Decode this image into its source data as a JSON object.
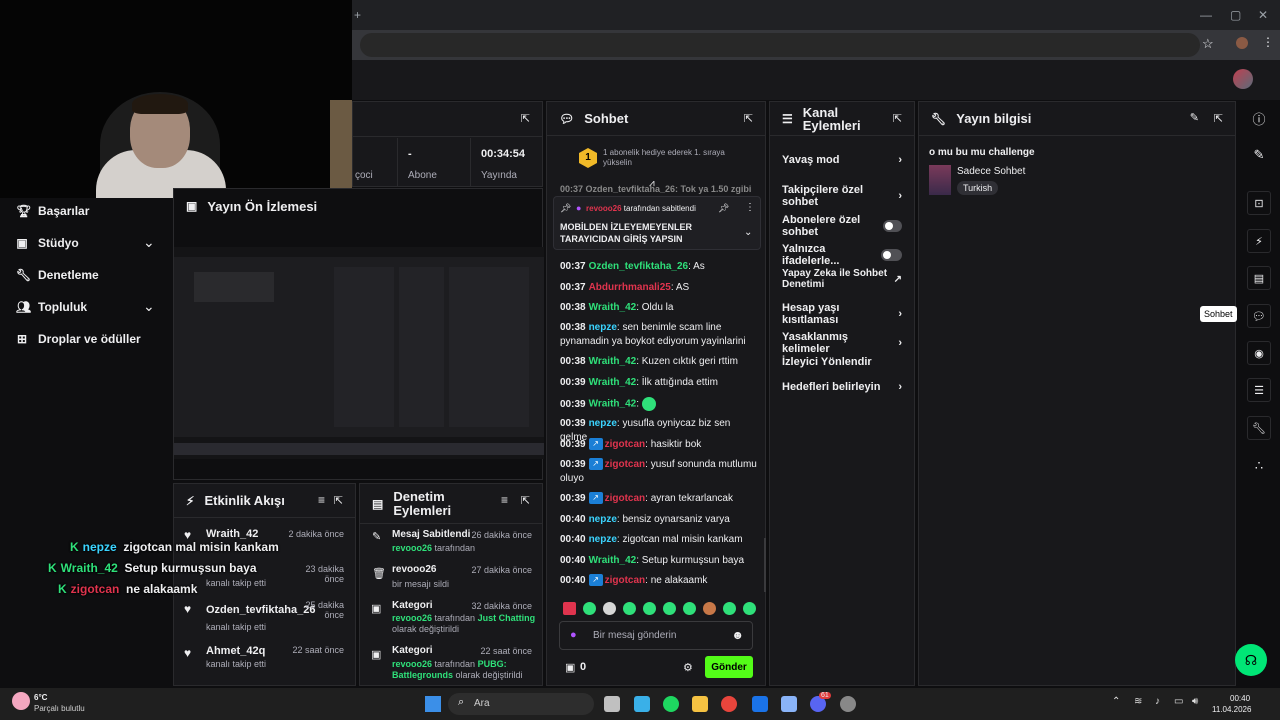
{
  "browser": {
    "win_minimize": "—",
    "win_restore": "▢",
    "win_close": "✕",
    "tab_plus": "+"
  },
  "sidebar": {
    "items": [
      {
        "label": "Başarılar",
        "icon": "trophy-icon"
      },
      {
        "label": "Stüdyo",
        "icon": "studio-icon",
        "expandable": true
      },
      {
        "label": "Denetleme",
        "icon": "wrench-icon"
      },
      {
        "label": "Topluluk",
        "icon": "community-icon",
        "expandable": true
      },
      {
        "label": "Droplar ve ödüller",
        "icon": "drops-icon"
      }
    ]
  },
  "stats": {
    "col1_value": "",
    "col1_label": "çoci",
    "col2_value": "-",
    "col2_label": "Abone",
    "col3_value": "00:34:54",
    "col3_label": "Yayında"
  },
  "preview": {
    "title": "Yayın Ön İzlemesi"
  },
  "activity": {
    "title": "Etkinlik Akışı",
    "items": [
      {
        "name": "Wraith_42",
        "time": "2 dakika önce",
        "sub": "kanalı takip etti"
      },
      {
        "name": "",
        "time": "23 dakika önce",
        "sub": "kanalı takip etti"
      },
      {
        "name": "Ozden_tevfiktaha_26",
        "time": "25 dakika önce",
        "sub": "kanalı takip etti"
      },
      {
        "name": "Ahmet_42q",
        "time": "22 saat önce",
        "sub": "kanalı takip etti"
      }
    ]
  },
  "modlog": {
    "title": "Denetim Eylemleri",
    "items": [
      {
        "title": "Mesaj Sabitlendi",
        "time": "26 dakika önce",
        "user": "revooo26",
        "rest": " tarafından"
      },
      {
        "title": "revooo26",
        "time": "27 dakika önce",
        "user": "",
        "rest": "bir mesajı sildi"
      },
      {
        "title": "Kategori",
        "time": "32 dakika önce",
        "user": "revooo26",
        "rest": " tarafından ",
        "highlight": "Just Chatting",
        "after": "olarak değiştirildi"
      },
      {
        "title": "Kategori",
        "time": "22 saat önce",
        "user": "revooo26",
        "rest": " tarafından ",
        "highlight": "PUBG: Battlegrounds",
        "after": " olarak değiştirildi"
      }
    ]
  },
  "chat": {
    "title": "Sohbet",
    "gift_text": "1 abonelik hediye ederek 1. sıraya yükselin",
    "gift_rank": "1",
    "clipped_line": "00:37 Ozden_tevfiktaha_26: Tok ya 1.50 zgibi",
    "pinned_by": "revooo26",
    "pinned_by_suffix": " tarafından sabitlendi",
    "pinned_text": "MOBİLDEN İZLEYEMEYENLER TARAYICIDAN GİRİŞ YAPSIN",
    "messages": [
      {
        "t": "00:37",
        "u": "Ozden_tevfiktaha_26",
        "c": "green",
        "m": ": As"
      },
      {
        "t": "00:37",
        "u": "Abdurrhmanali25",
        "c": "red",
        "m": ": AS"
      },
      {
        "t": "00:38",
        "u": "Wraith_42",
        "c": "green",
        "m": ": Oldu la"
      },
      {
        "t": "00:38",
        "u": "nepze",
        "c": "cyan",
        "m": ": sen benimle scam line pynamadin ya boykot ediyorum yayinlarini"
      },
      {
        "t": "00:38",
        "u": "Wraith_42",
        "c": "green",
        "m": ": Kuzen cıktık geri rttim"
      },
      {
        "t": "00:39",
        "u": "Wraith_42",
        "c": "green",
        "m": ": İlk attığında ettim"
      },
      {
        "t": "00:39",
        "u": "Wraith_42",
        "c": "green",
        "m": ":"
      },
      {
        "t": "00:39",
        "u": "nepze",
        "c": "cyan",
        "m": ": yusufla oyniycaz biz sen gelme"
      },
      {
        "t": "00:39",
        "u": "zigotcan",
        "c": "red",
        "m": ": hasiktir bok",
        "badge": true
      },
      {
        "t": "00:39",
        "u": "zigotcan",
        "c": "red",
        "m": ": yusuf sonunda mutlumu oluyo",
        "badge": true
      },
      {
        "t": "00:39",
        "u": "zigotcan",
        "c": "red",
        "m": ": ayran tekrarlancak",
        "badge": true
      },
      {
        "t": "00:40",
        "u": "nepze",
        "c": "cyan",
        "m": ": bensiz oynarsaniz varya"
      },
      {
        "t": "00:40",
        "u": "nepze",
        "c": "cyan",
        "m": ": zigotcan mal misin kankam"
      },
      {
        "t": "00:40",
        "u": "Wraith_42",
        "c": "green",
        "m": ": Setup kurmuşsun baya"
      },
      {
        "t": "00:40",
        "u": "zigotcan",
        "c": "red",
        "m": ": ne alakaamk",
        "badge": true
      }
    ],
    "input_placeholder": "Bir mesaj gönderin",
    "points": "0",
    "send_label": "Gönder"
  },
  "channel_actions": {
    "title": "Kanal Eylemleri",
    "items": [
      {
        "label": "Yavaş mod",
        "control": "chevron"
      },
      {
        "label": "Takipçilere özel sohbet",
        "control": "chevron"
      },
      {
        "label": "Abonelere özel sohbet",
        "control": "toggle"
      },
      {
        "label": "Yalnızca ifadelerle...",
        "control": "toggle"
      },
      {
        "label": "Yapay Zeka ile Sohbet Denetimi",
        "control": "external"
      },
      {
        "label": "Hesap yaşı kısıtlaması",
        "control": "chevron"
      },
      {
        "label": "Yasaklanmış kelimeler",
        "control": "chevron"
      },
      {
        "label": "İzleyici Yönlendir",
        "control": "none"
      },
      {
        "label": "Hedefleri belirleyin",
        "control": "chevron"
      }
    ]
  },
  "stream_info": {
    "title": "Yayın bilgisi",
    "stream_title": "o mu bu mu challenge",
    "category": "Sadece Sohbet",
    "tag": "Turkish"
  },
  "rail": {
    "tooltip": "Sohbet"
  },
  "overlay_chat": [
    {
      "u": "nepze",
      "c": "cyan",
      "m": "zigotcan mal misin kankam"
    },
    {
      "u": "Wraith_42",
      "c": "green",
      "m": "Setup kurmuşsun baya"
    },
    {
      "u": "zigotcan",
      "c": "red",
      "m": "ne alakaamk"
    }
  ],
  "taskbar": {
    "weather_temp": "6°C",
    "weather_desc": "Parçalı bulutlu",
    "search_label": "Ara",
    "time": "00:40",
    "date": "11.04.2026",
    "discord_badge": "61"
  },
  "colors": {
    "accent": "#9147ff",
    "green": "#2fe07a",
    "send": "#00c853",
    "bg": "#0e0e10",
    "panel": "#18181b"
  }
}
